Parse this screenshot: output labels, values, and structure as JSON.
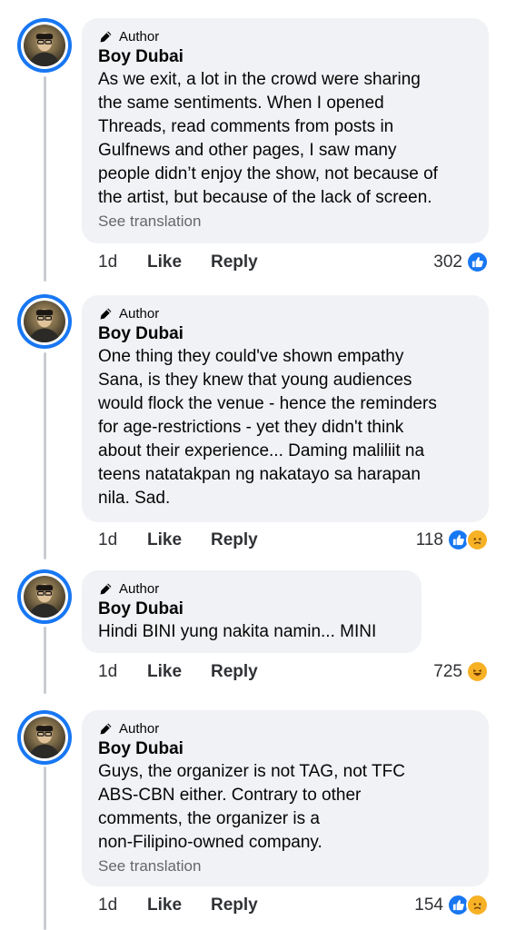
{
  "comments": [
    {
      "badge": "Author",
      "name": "Boy Dubai",
      "text": "As we exit, a lot in the crowd were sharing\nthe same sentiments. When I opened\nThreads, read comments from posts in\nGulfnews and other pages, I saw many\npeople didn’t enjoy the show, not because of\nthe artist, but because of the lack of screen.",
      "see_translation": "See translation",
      "time": "1d",
      "like": "Like",
      "reply": "Reply",
      "reaction_count": "302",
      "reactions": [
        "like-icon"
      ]
    },
    {
      "badge": "Author",
      "name": "Boy Dubai",
      "text": "One thing they could've shown empathy\nSana, is they knew that young audiences\nwould flock the venue - hence the reminders\nfor age-restrictions - yet they didn't think\nabout their experience... Daming maliliit na\nteens natatakpan ng nakatayo sa harapan\nnila. Sad.",
      "see_translation": "",
      "time": "1d",
      "like": "Like",
      "reply": "Reply",
      "reaction_count": "118",
      "reactions": [
        "like-icon",
        "sad-icon"
      ]
    },
    {
      "badge": "Author",
      "name": "Boy Dubai",
      "text": "Hindi BINI yung nakita namin... MINI",
      "see_translation": "",
      "time": "1d",
      "like": "Like",
      "reply": "Reply",
      "reaction_count": "725",
      "reactions": [
        "haha-icon"
      ]
    },
    {
      "badge": "Author",
      "name": "Boy Dubai",
      "text": "Guys, the organizer is not TAG, not TFC\nABS-CBN either. Contrary to other\ncomments, the organizer is a\nnon-Filipino-owned company.",
      "see_translation": "See translation",
      "time": "1d",
      "like": "Like",
      "reply": "Reply",
      "reaction_count": "154",
      "reactions": [
        "like-icon",
        "sad-icon"
      ]
    }
  ],
  "colors": {
    "accent": "#1877f2",
    "bubble": "#f0f2f5",
    "muted": "#65676b"
  }
}
